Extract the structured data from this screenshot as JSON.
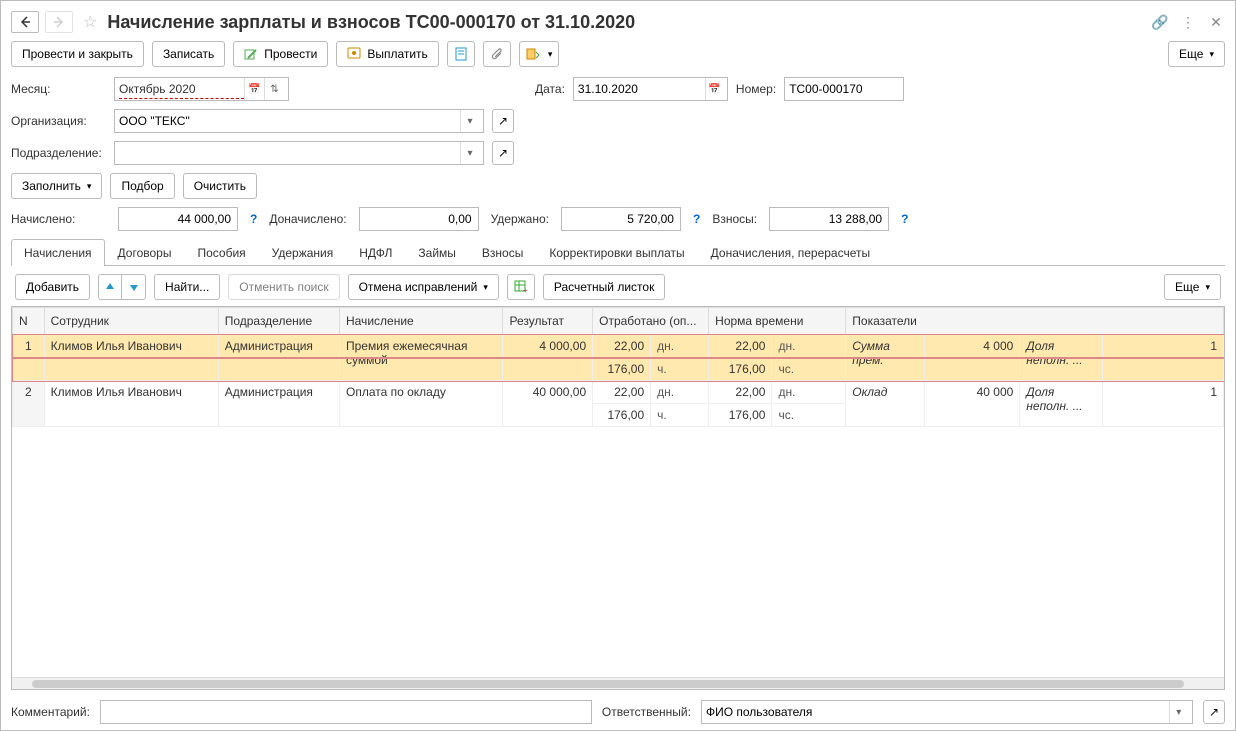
{
  "title": "Начисление зарплаты и взносов ТС00-000170 от 31.10.2020",
  "toolbar": {
    "post_close": "Провести и закрыть",
    "save": "Записать",
    "post": "Провести",
    "pay": "Выплатить",
    "more": "Еще"
  },
  "form": {
    "month_label": "Месяц:",
    "month_value": "Октябрь 2020",
    "date_label": "Дата:",
    "date_value": "31.10.2020",
    "number_label": "Номер:",
    "number_value": "ТС00-000170",
    "org_label": "Организация:",
    "org_value": "ООО \"ТЕКС\"",
    "dept_label": "Подразделение:",
    "dept_value": ""
  },
  "actions": {
    "fill": "Заполнить",
    "pick": "Подбор",
    "clear": "Очистить"
  },
  "totals": {
    "accrued_label": "Начислено:",
    "accrued_value": "44 000,00",
    "addl_label": "Доначислено:",
    "addl_value": "0,00",
    "withheld_label": "Удержано:",
    "withheld_value": "5 720,00",
    "contrib_label": "Взносы:",
    "contrib_value": "13 288,00"
  },
  "tabs": {
    "t0": "Начисления",
    "t1": "Договоры",
    "t2": "Пособия",
    "t3": "Удержания",
    "t4": "НДФЛ",
    "t5": "Займы",
    "t6": "Взносы",
    "t7": "Корректировки выплаты",
    "t8": "Доначисления, перерасчеты"
  },
  "tab_toolbar": {
    "add": "Добавить",
    "find": "Найти...",
    "cancel_search": "Отменить поиск",
    "cancel_fix": "Отмена исправлений",
    "payslip": "Расчетный листок",
    "more": "Еще"
  },
  "grid": {
    "headers": {
      "n": "N",
      "emp": "Сотрудник",
      "dept": "Подразделение",
      "accr": "Начисление",
      "res": "Результат",
      "worked": "Отработано (оп...",
      "norm": "Норма времени",
      "ind": "Показатели"
    },
    "rows": [
      {
        "n": "1",
        "emp": "Климов Илья Иванович",
        "dept": "Администрация",
        "accr": "Премия ежемесячная суммой",
        "res": "4 000,00",
        "wd": "22,00",
        "wdu": "дн.",
        "wh": "176,00",
        "whu": "ч.",
        "nd": "22,00",
        "ndu": "дн.",
        "nh": "176,00",
        "nhu": "чс.",
        "ind_name": "Сумма прем.",
        "ind_val": "4 000",
        "ind2": "Доля неполн. ...",
        "tail": "1",
        "selected": true
      },
      {
        "n": "2",
        "emp": "Климов Илья Иванович",
        "dept": "Администрация",
        "accr": "Оплата по окладу",
        "res": "40 000,00",
        "wd": "22,00",
        "wdu": "дн.",
        "wh": "176,00",
        "whu": "ч.",
        "nd": "22,00",
        "ndu": "дн.",
        "nh": "176,00",
        "nhu": "чс.",
        "ind_name": "Оклад",
        "ind_val": "40 000",
        "ind2": "Доля неполн. ...",
        "tail": "1",
        "selected": false
      }
    ]
  },
  "footer": {
    "comment_label": "Комментарий:",
    "comment_value": "",
    "resp_label": "Ответственный:",
    "resp_value": "ФИО пользователя"
  },
  "units": {
    "dn": "дн.",
    "chs": "чс.",
    "ch": "ч."
  }
}
